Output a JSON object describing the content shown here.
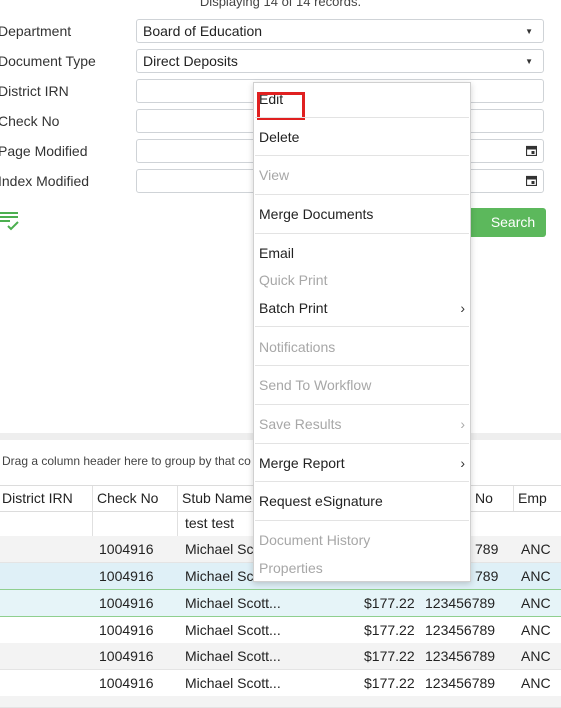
{
  "status_text": "Displaying 14 of 14 records.",
  "form": {
    "department": {
      "label": "Department",
      "value": "Board of Education"
    },
    "document_type": {
      "label": "Document Type",
      "value": "Direct Deposits"
    },
    "district_irn": {
      "label": "District IRN",
      "value": ""
    },
    "check_no": {
      "label": "Check No",
      "value": ""
    },
    "page_modified": {
      "label": "Page Modified",
      "value": ""
    },
    "index_modified": {
      "label": "Index Modified",
      "value": ""
    },
    "search_label": "Search"
  },
  "context_menu": {
    "items": [
      {
        "label": "Edit",
        "enabled": true
      },
      {
        "label": "Delete",
        "enabled": true
      },
      {
        "label": "View",
        "enabled": false
      },
      {
        "label": "Merge Documents",
        "enabled": true
      },
      {
        "label": "Email",
        "enabled": true
      },
      {
        "label": "Quick Print",
        "enabled": false
      },
      {
        "label": "Batch Print",
        "enabled": true
      },
      {
        "label": "Notifications",
        "enabled": false
      },
      {
        "label": "Send To Workflow",
        "enabled": false
      },
      {
        "label": "Save Results",
        "enabled": false
      },
      {
        "label": "Merge Report",
        "enabled": true
      },
      {
        "label": "Request eSignature",
        "enabled": true
      },
      {
        "label": "Document History",
        "enabled": false
      },
      {
        "label": "Properties",
        "enabled": false
      }
    ]
  },
  "grid": {
    "group_hint": "Drag a column header here to group by that co",
    "columns": [
      "District IRN",
      "Check No",
      "Stub Name",
      "No",
      "Emp"
    ],
    "filter_stub_name": "test test",
    "rows": [
      {
        "check_no": "1004916",
        "stub_name": "Michael Sco",
        "amount": "",
        "no": "789",
        "emp": "ANC"
      },
      {
        "check_no": "1004916",
        "stub_name": "Michael Sco",
        "amount": "",
        "no": "789",
        "emp": "ANC"
      },
      {
        "check_no": "1004916",
        "stub_name": "Michael Scott...",
        "amount": "$177.22",
        "no": "123456789",
        "emp": "ANC"
      },
      {
        "check_no": "1004916",
        "stub_name": "Michael Scott...",
        "amount": "$177.22",
        "no": "123456789",
        "emp": "ANC"
      },
      {
        "check_no": "1004916",
        "stub_name": "Michael Scott...",
        "amount": "$177.22",
        "no": "123456789",
        "emp": "ANC"
      },
      {
        "check_no": "1004916",
        "stub_name": "Michael Scott...",
        "amount": "$177.22",
        "no": "123456789",
        "emp": "ANC"
      }
    ]
  }
}
